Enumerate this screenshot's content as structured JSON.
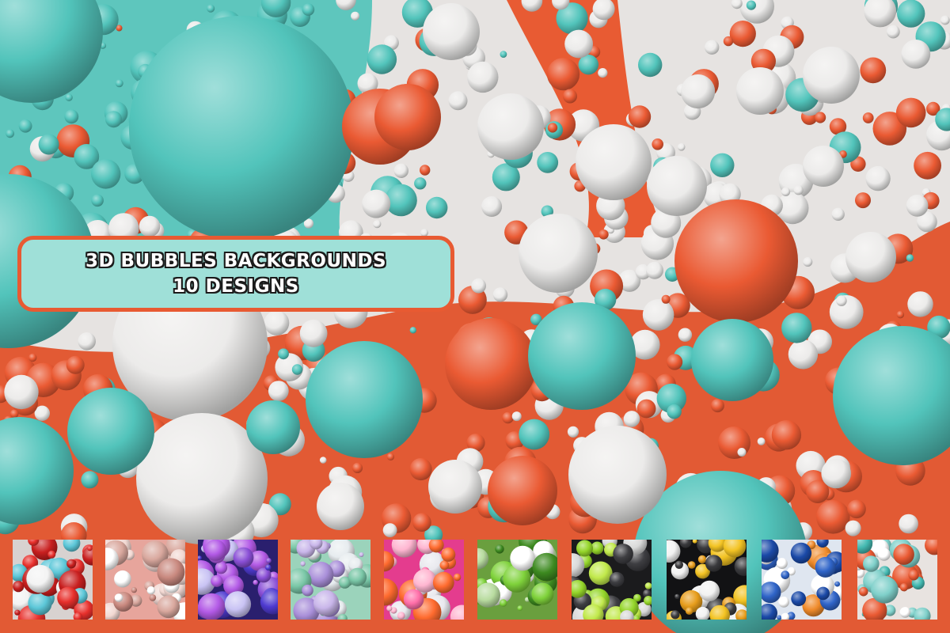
{
  "banner": {
    "title": "3D BUBBLES BACKGROUNDS",
    "subtitle": "10 DESIGNS"
  },
  "colors": {
    "teal": "#52c4bb",
    "orange": "#ea5a33",
    "white": "#ecebea",
    "banner_fill": "#9fe0d8",
    "banner_border": "#e85a32"
  },
  "thumbnails": [
    {
      "name": "red-teal-white",
      "bg": "#d8d2d0",
      "colors": [
        "#e8302c",
        "#5cc7d8",
        "#f3f3f3",
        "#c81f1f"
      ]
    },
    {
      "name": "pink-beige",
      "bg": "#e7a59c",
      "colors": [
        "#f2d8d2",
        "#d9a89e",
        "#ffffff",
        "#c9897f"
      ]
    },
    {
      "name": "purple-blue",
      "bg": "#2a1f6e",
      "colors": [
        "#8a4fd6",
        "#4e3ad0",
        "#c9c3f4",
        "#b35ae6"
      ]
    },
    {
      "name": "mint-lavender",
      "bg": "#9bd3bb",
      "colors": [
        "#c9b6ea",
        "#e7ecef",
        "#7ac7a7",
        "#a98fd9"
      ]
    },
    {
      "name": "pink-magenta",
      "bg": "#e43c8e",
      "colors": [
        "#ff6fa9",
        "#ffb6d1",
        "#ff6b2f",
        "#e9e9ee"
      ]
    },
    {
      "name": "green-white",
      "bg": "#6a9f3e",
      "colors": [
        "#ffffff",
        "#7fd23b",
        "#b9dca0",
        "#3d8a20"
      ]
    },
    {
      "name": "black-lime",
      "bg": "#1b1b1d",
      "colors": [
        "#95d62a",
        "#c1e94b",
        "#3e3e42",
        "#d9d9d9"
      ]
    },
    {
      "name": "black-yellow-white",
      "bg": "#121214",
      "colors": [
        "#f3c323",
        "#f2f2f2",
        "#e79d1c",
        "#3a3a3d"
      ]
    },
    {
      "name": "blue-orange-white",
      "bg": "#dfe6f0",
      "colors": [
        "#2f64c8",
        "#ef8a2a",
        "#ffffff",
        "#1b4aa8"
      ]
    },
    {
      "name": "teal-orange-white",
      "bg": "#e8e3e0",
      "colors": [
        "#43b9b1",
        "#ea5a33",
        "#ffffff",
        "#7fd0ca"
      ]
    }
  ]
}
